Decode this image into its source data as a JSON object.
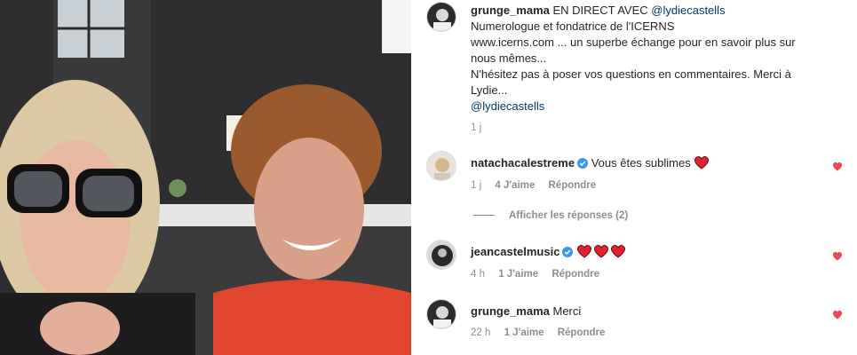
{
  "post": {
    "author": "grunge_mama",
    "headline": "EN DIRECT AVEC",
    "mention": "@lydiecastells",
    "lines": [
      "Numerologue et fondatrice de l'ICERNS",
      "www.icerns.com ... un superbe échange pour en savoir plus sur",
      "nous mêmes...",
      "N'hésitez pas à poser vos questions en commentaires. Merci à",
      "Lydie..."
    ],
    "mention_end": "@lydiecastells",
    "time": "1 j"
  },
  "comments": [
    {
      "username": "natachacalestreme",
      "verified": true,
      "text": "Vous êtes sublimes",
      "emoji": "red-heart",
      "time": "1 j",
      "likes": "4 J'aime",
      "reply": "Répondre"
    },
    {
      "username": "jeancastelmusic",
      "verified": true,
      "text": "",
      "emoji": "three-red-hearts",
      "time": "4 h",
      "likes": "1 J'aime",
      "reply": "Répondre"
    },
    {
      "username": "grunge_mama",
      "verified": false,
      "text": "Merci",
      "emoji": "",
      "time": "22 h",
      "likes": "1 J'aime",
      "reply": "Répondre"
    }
  ],
  "view_replies": "Afficher les réponses (2)",
  "colors": {
    "heart": "#ed4956",
    "verified": "#3897f0",
    "mention": "#00376b",
    "meta": "#8e8e8e"
  }
}
